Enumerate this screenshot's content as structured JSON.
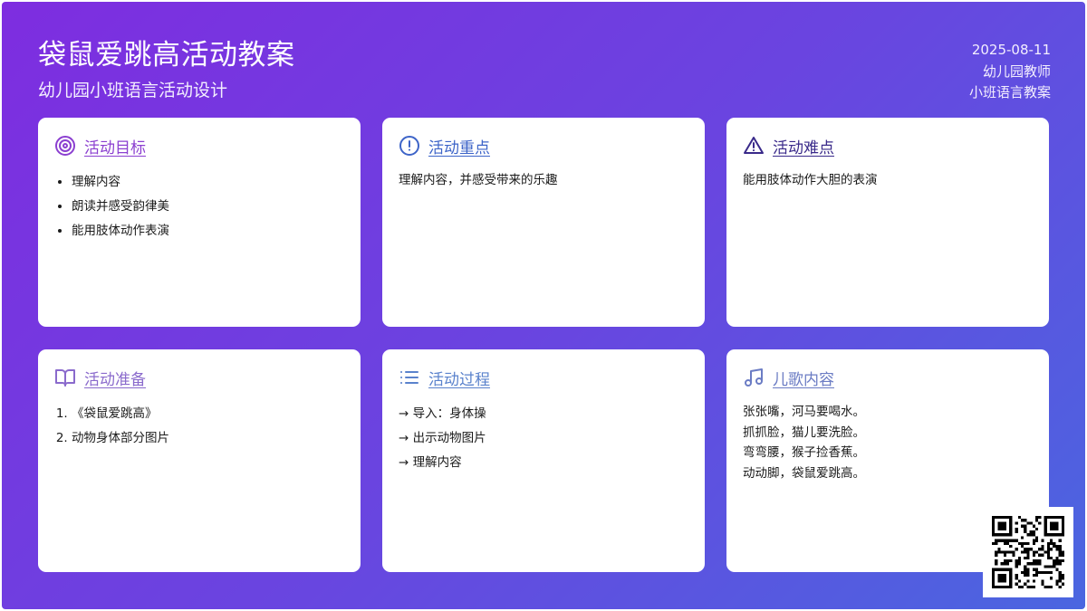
{
  "header": {
    "title": "袋鼠爱跳高活动教案",
    "subtitle": "幼儿园小班语言活动设计",
    "date": "2025-08-11",
    "author": "幼儿园教师",
    "category": "小班语言教案"
  },
  "cards": {
    "goals": {
      "title": "活动目标",
      "icon": "target-icon",
      "color": "#8b3fd0",
      "items": [
        "理解内容",
        "朗读并感受韵律美",
        "能用肢体动作表演"
      ]
    },
    "focus": {
      "title": "活动重点",
      "icon": "alert-circle-icon",
      "color": "#3d64c8",
      "text": "理解内容，并感受带来的乐趣"
    },
    "difficulty": {
      "title": "活动难点",
      "icon": "warning-triangle-icon",
      "color": "#3a2a8a",
      "text": "能用肢体动作大胆的表演"
    },
    "preparation": {
      "title": "活动准备",
      "icon": "book-open-icon",
      "color": "#8a6acc",
      "items": [
        "《袋鼠爱跳高》",
        "动物身体部分图片"
      ]
    },
    "process": {
      "title": "活动过程",
      "icon": "list-icon",
      "color": "#5a82cc",
      "steps": [
        "→ 导入：身体操",
        "→ 出示动物图片",
        "→ 理解内容"
      ]
    },
    "song": {
      "title": "儿歌内容",
      "icon": "music-note-icon",
      "color": "#6b7cc4",
      "lines": [
        "张张嘴，河马要喝水。",
        "抓抓脸，猫儿要洗脸。",
        "弯弯腰，猴子捡香蕉。",
        "动动脚，袋鼠爱跳高。"
      ]
    }
  },
  "qr_code": {
    "icon": "qr-code-icon"
  }
}
